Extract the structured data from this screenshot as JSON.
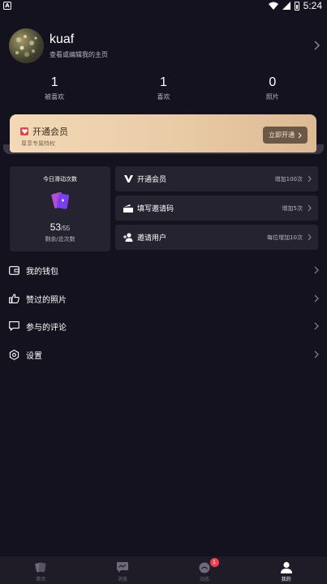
{
  "status_bar": {
    "notification_icon": "A",
    "time": "5:24",
    "icons": [
      "wifi-icon",
      "signal-icon",
      "battery-icon"
    ]
  },
  "profile": {
    "username": "kuaf",
    "subtitle": "查看或编辑我的主页"
  },
  "stats": [
    {
      "value": "1",
      "label": "被喜欢"
    },
    {
      "value": "1",
      "label": "喜欢"
    },
    {
      "value": "0",
      "label": "照片"
    }
  ],
  "vip_banner": {
    "title": "开通会员",
    "subtitle": "尊享专属特权",
    "button_label": "立即开通",
    "colors": {
      "gold_start": "#f3d9b6",
      "gold_end": "#dcba94",
      "button": "#6b5846",
      "badge": "#e2464c"
    }
  },
  "swipe_card": {
    "title": "今日滑动次数",
    "remaining": "53",
    "total": "/55",
    "label": "剩余/总次数",
    "icon": "cards-icon"
  },
  "actions": [
    {
      "label": "开通会员",
      "detail": "增加100次",
      "icon": "vip-v-icon"
    },
    {
      "label": "填写邀请码",
      "detail": "增加5次",
      "icon": "ticket-icon"
    },
    {
      "label": "邀请用户",
      "detail": "每位增加10次",
      "icon": "add-user-icon"
    }
  ],
  "menu": [
    {
      "label": "我的钱包",
      "icon": "wallet-icon"
    },
    {
      "label": "赞过的照片",
      "icon": "thumb-up-icon"
    },
    {
      "label": "参与的评论",
      "icon": "comment-icon"
    },
    {
      "label": "设置",
      "icon": "settings-icon"
    }
  ],
  "bottom_nav": [
    {
      "label": "首页",
      "icon": "cards-nav-icon",
      "active": false
    },
    {
      "label": "消息",
      "icon": "message-icon",
      "active": false
    },
    {
      "label": "动态",
      "icon": "moments-icon",
      "active": false,
      "badge": "1"
    },
    {
      "label": "我的",
      "icon": "profile-icon",
      "active": true
    }
  ],
  "colors": {
    "background": "#15121f",
    "card": "#25232f",
    "nav_bg": "#1f1c28",
    "badge_red": "#ef3f53"
  }
}
